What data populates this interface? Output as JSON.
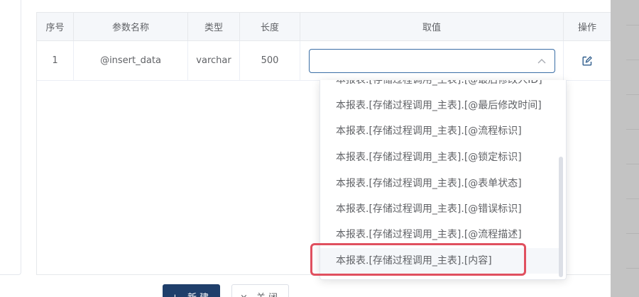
{
  "table": {
    "headers": [
      "序号",
      "参数名称",
      "类型",
      "长度",
      "取值",
      "操作"
    ],
    "rows": [
      {
        "index": "1",
        "name": "@insert_data",
        "type": "varchar",
        "length": "500",
        "value": ""
      }
    ]
  },
  "dropdown": {
    "partial_top_option": "本报表.[存储过程调用_主表].[@最后修改人ID]",
    "options": [
      "本报表.[存储过程调用_主表].[@最后修改时间]",
      "本报表.[存储过程调用_主表].[@流程标识]",
      "本报表.[存储过程调用_主表].[@锁定标识]",
      "本报表.[存储过程调用_主表].[@表单状态]",
      "本报表.[存储过程调用_主表].[@错误标识]",
      "本报表.[存储过程调用_主表].[@流程描述]",
      "本报表.[存储过程调用_主表].[内容]"
    ]
  },
  "buttons": {
    "new_label": "+ 新建",
    "close_label": "× 关闭"
  },
  "colors": {
    "primary": "#1f3f6b",
    "highlight": "#e0505f",
    "select_border": "#3a6ea5"
  },
  "icons": {
    "select_arrow": "chevron-up-icon",
    "row_action": "edit-icon"
  }
}
